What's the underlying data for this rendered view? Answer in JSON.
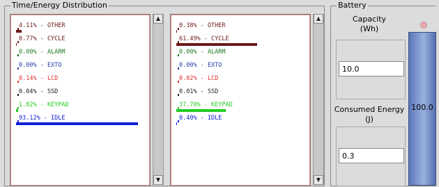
{
  "distribution": {
    "title": "Time/Energy Distribution",
    "time": [
      {
        "label": "4.11% - OTHER",
        "color": "#6b1a1a",
        "fraction": 0.0411
      },
      {
        "label": "0.77% - CYCLE",
        "color": "#6b1a1a",
        "fraction": 0.0077
      },
      {
        "label": "0.00% - ALARM",
        "color": "#1f7a1f",
        "fraction": 0.0
      },
      {
        "label": "0.00% - EXTO",
        "color": "#1f3fa8",
        "fraction": 0.0
      },
      {
        "label": "0.14% - LCD",
        "color": "#e03030",
        "fraction": 0.0014
      },
      {
        "label": "0.04% - SSD",
        "color": "#222222",
        "fraction": 0.0004
      },
      {
        "label": "1.82% - KEYPAD",
        "color": "#22cc22",
        "fraction": 0.0182
      },
      {
        "label": "93.12% - IDLE",
        "color": "#1020d8",
        "fraction": 0.9312
      }
    ],
    "energy": [
      {
        "label": "0.38% - OTHER",
        "color": "#6b1a1a",
        "fraction": 0.0038
      },
      {
        "label": "61.49% - CYCLE",
        "color": "#6b1a1a",
        "fraction": 0.6149
      },
      {
        "label": "0.00% - ALARM",
        "color": "#1f7a1f",
        "fraction": 0.0
      },
      {
        "label": "0.00% - EXTO",
        "color": "#1f3fa8",
        "fraction": 0.0
      },
      {
        "label": "0.02% - LCD",
        "color": "#e03030",
        "fraction": 0.0002
      },
      {
        "label": "0.01% - SSD",
        "color": "#222222",
        "fraction": 0.0001
      },
      {
        "label": "37.70% - KEYPAD",
        "color": "#22cc22",
        "fraction": 0.377
      },
      {
        "label": "0.40% - IDLE",
        "color": "#1020d8",
        "fraction": 0.004
      }
    ]
  },
  "battery": {
    "title": "Battery",
    "capacity_label": "Capacity\n(Wh)",
    "capacity_value": "10.0",
    "consumed_label": "Consumed Energy\n(J)",
    "consumed_value": "0.3",
    "level_text": "100.0",
    "level_fraction": 1.0
  }
}
